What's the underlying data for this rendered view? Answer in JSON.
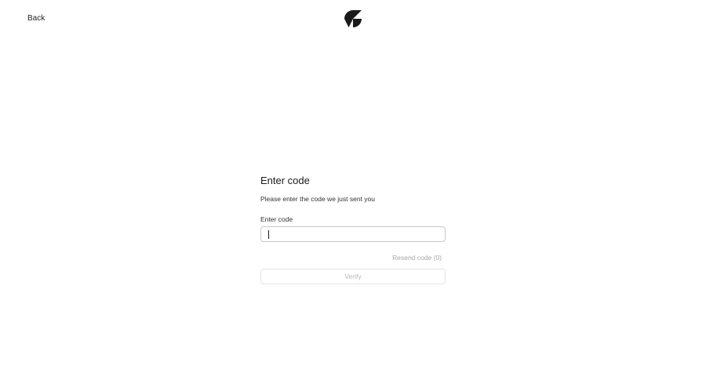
{
  "header": {
    "back_label": "Back",
    "logo_icon": "brand-logo-icon"
  },
  "form": {
    "title": "Enter code",
    "subtitle": "Please enter the code we just sent you",
    "code_field": {
      "label": "Enter code",
      "value": "",
      "placeholder": ""
    },
    "resend_label": "Resend code (0)",
    "verify_label": "Verify"
  },
  "colors": {
    "text": "#1f1f1f",
    "disabled_text": "#a6a6a6",
    "input_border": "#c9c9c9",
    "button_border": "#e3e3e3"
  }
}
